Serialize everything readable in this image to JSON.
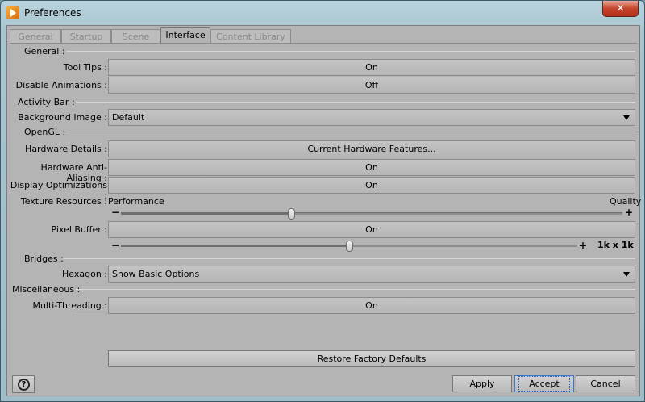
{
  "window": {
    "title": "Preferences",
    "close": "✕"
  },
  "tabs": [
    {
      "label": "General"
    },
    {
      "label": "Startup"
    },
    {
      "label": "Scene"
    },
    {
      "label": "Interface"
    },
    {
      "label": "Content Library"
    }
  ],
  "sections": {
    "general": "General :",
    "activity_bar": "Activity Bar :",
    "opengl": "OpenGL :",
    "bridges": "Bridges :",
    "misc": "Miscellaneous :"
  },
  "rows": {
    "tool_tips": {
      "label": "Tool Tips :",
      "value": "On"
    },
    "disable_animations": {
      "label": "Disable Animations :",
      "value": "Off"
    },
    "background_image": {
      "label": "Background Image :",
      "value": "Default"
    },
    "hardware_details": {
      "label": "Hardware Details :",
      "value": "Current Hardware Features..."
    },
    "anti_aliasing": {
      "label": "Hardware Anti-Aliasing :",
      "value": "On"
    },
    "display_optimizations": {
      "label": "Display Optimizations :",
      "value": "On"
    },
    "texture_resources": {
      "label": "Texture Resources :",
      "left": "Performance",
      "right": "Quality",
      "minus": "−",
      "plus": "+",
      "level": 0.34
    },
    "pixel_buffer": {
      "label": "Pixel Buffer :",
      "value": "On",
      "minus": "−",
      "plus": "+",
      "size": "1k x 1k",
      "level": 0.5
    },
    "hexagon": {
      "label": "Hexagon :",
      "value": "Show Basic Options"
    },
    "multi_threading": {
      "label": "Multi-Threading :",
      "value": "On"
    }
  },
  "buttons": {
    "restore": "Restore Factory Defaults",
    "help": "?",
    "apply": "Apply",
    "accept": "Accept",
    "cancel": "Cancel"
  }
}
